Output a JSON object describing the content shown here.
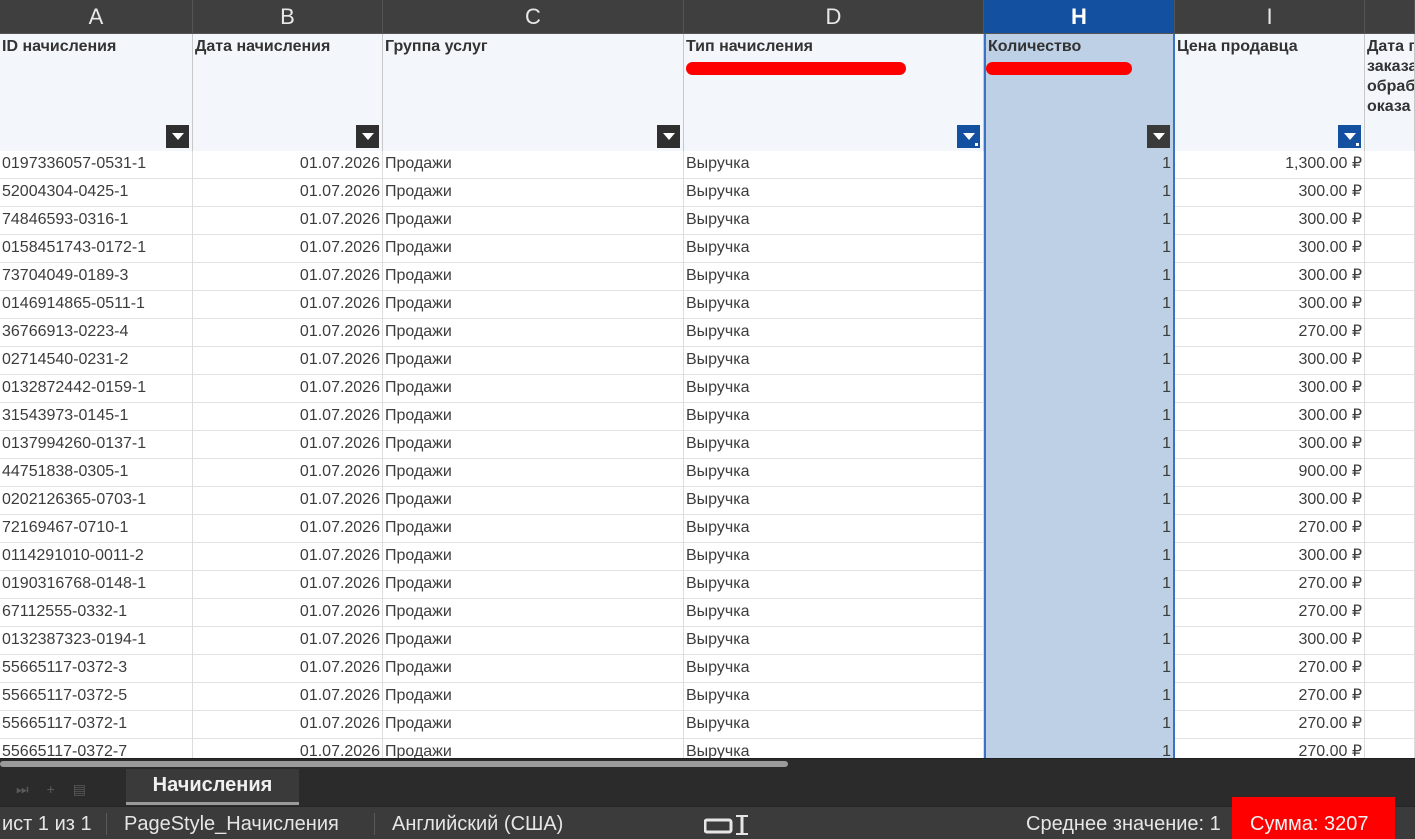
{
  "column_letters": [
    "A",
    "B",
    "C",
    "D",
    "H",
    "I",
    ""
  ],
  "selected_column": "H",
  "field_headers": [
    "ID начисления",
    "Дата начисления",
    "Группа услуг",
    "Тип начисления",
    "Количество",
    "Цена продавца",
    "Дата п заказа обраб оказа"
  ],
  "rows": [
    [
      "0197336057-0531-1",
      "01.07.2026",
      "Продажи",
      "Выручка",
      "1",
      "1,300.00 ₽"
    ],
    [
      "52004304-0425-1",
      "01.07.2026",
      "Продажи",
      "Выручка",
      "1",
      "300.00 ₽"
    ],
    [
      "74846593-0316-1",
      "01.07.2026",
      "Продажи",
      "Выручка",
      "1",
      "300.00 ₽"
    ],
    [
      "0158451743-0172-1",
      "01.07.2026",
      "Продажи",
      "Выручка",
      "1",
      "300.00 ₽"
    ],
    [
      "73704049-0189-3",
      "01.07.2026",
      "Продажи",
      "Выручка",
      "1",
      "300.00 ₽"
    ],
    [
      "0146914865-0511-1",
      "01.07.2026",
      "Продажи",
      "Выручка",
      "1",
      "300.00 ₽"
    ],
    [
      "36766913-0223-4",
      "01.07.2026",
      "Продажи",
      "Выручка",
      "1",
      "270.00 ₽"
    ],
    [
      "02714540-0231-2",
      "01.07.2026",
      "Продажи",
      "Выручка",
      "1",
      "300.00 ₽"
    ],
    [
      "0132872442-0159-1",
      "01.07.2026",
      "Продажи",
      "Выручка",
      "1",
      "300.00 ₽"
    ],
    [
      "31543973-0145-1",
      "01.07.2026",
      "Продажи",
      "Выручка",
      "1",
      "300.00 ₽"
    ],
    [
      "0137994260-0137-1",
      "01.07.2026",
      "Продажи",
      "Выручка",
      "1",
      "300.00 ₽"
    ],
    [
      "44751838-0305-1",
      "01.07.2026",
      "Продажи",
      "Выручка",
      "1",
      "900.00 ₽"
    ],
    [
      "0202126365-0703-1",
      "01.07.2026",
      "Продажи",
      "Выручка",
      "1",
      "300.00 ₽"
    ],
    [
      "72169467-0710-1",
      "01.07.2026",
      "Продажи",
      "Выручка",
      "1",
      "270.00 ₽"
    ],
    [
      "0114291010-0011-2",
      "01.07.2026",
      "Продажи",
      "Выручка",
      "1",
      "300.00 ₽"
    ],
    [
      "0190316768-0148-1",
      "01.07.2026",
      "Продажи",
      "Выручка",
      "1",
      "270.00 ₽"
    ],
    [
      "67112555-0332-1",
      "01.07.2026",
      "Продажи",
      "Выручка",
      "1",
      "270.00 ₽"
    ],
    [
      "0132387323-0194-1",
      "01.07.2026",
      "Продажи",
      "Выручка",
      "1",
      "300.00 ₽"
    ],
    [
      "55665117-0372-3",
      "01.07.2026",
      "Продажи",
      "Выручка",
      "1",
      "270.00 ₽"
    ],
    [
      "55665117-0372-5",
      "01.07.2026",
      "Продажи",
      "Выручка",
      "1",
      "270.00 ₽"
    ],
    [
      "55665117-0372-1",
      "01.07.2026",
      "Продажи",
      "Выручка",
      "1",
      "270.00 ₽"
    ],
    [
      "55665117-0372-7",
      "01.07.2026",
      "Продажи",
      "Выручка",
      "1",
      "270.00 ₽"
    ]
  ],
  "sheet_tab": "Начисления",
  "status": {
    "sheet_pos": "ист 1 из 1",
    "page_style": "PageStyle_Начисления",
    "language": "Английский (США)",
    "average": "Среднее значение: 1",
    "sum": "Сумма: 3207"
  },
  "colors": {
    "selected_header": "#1450a0",
    "selected_fill": "#bdd0e6",
    "redaction": "#ff0000"
  }
}
